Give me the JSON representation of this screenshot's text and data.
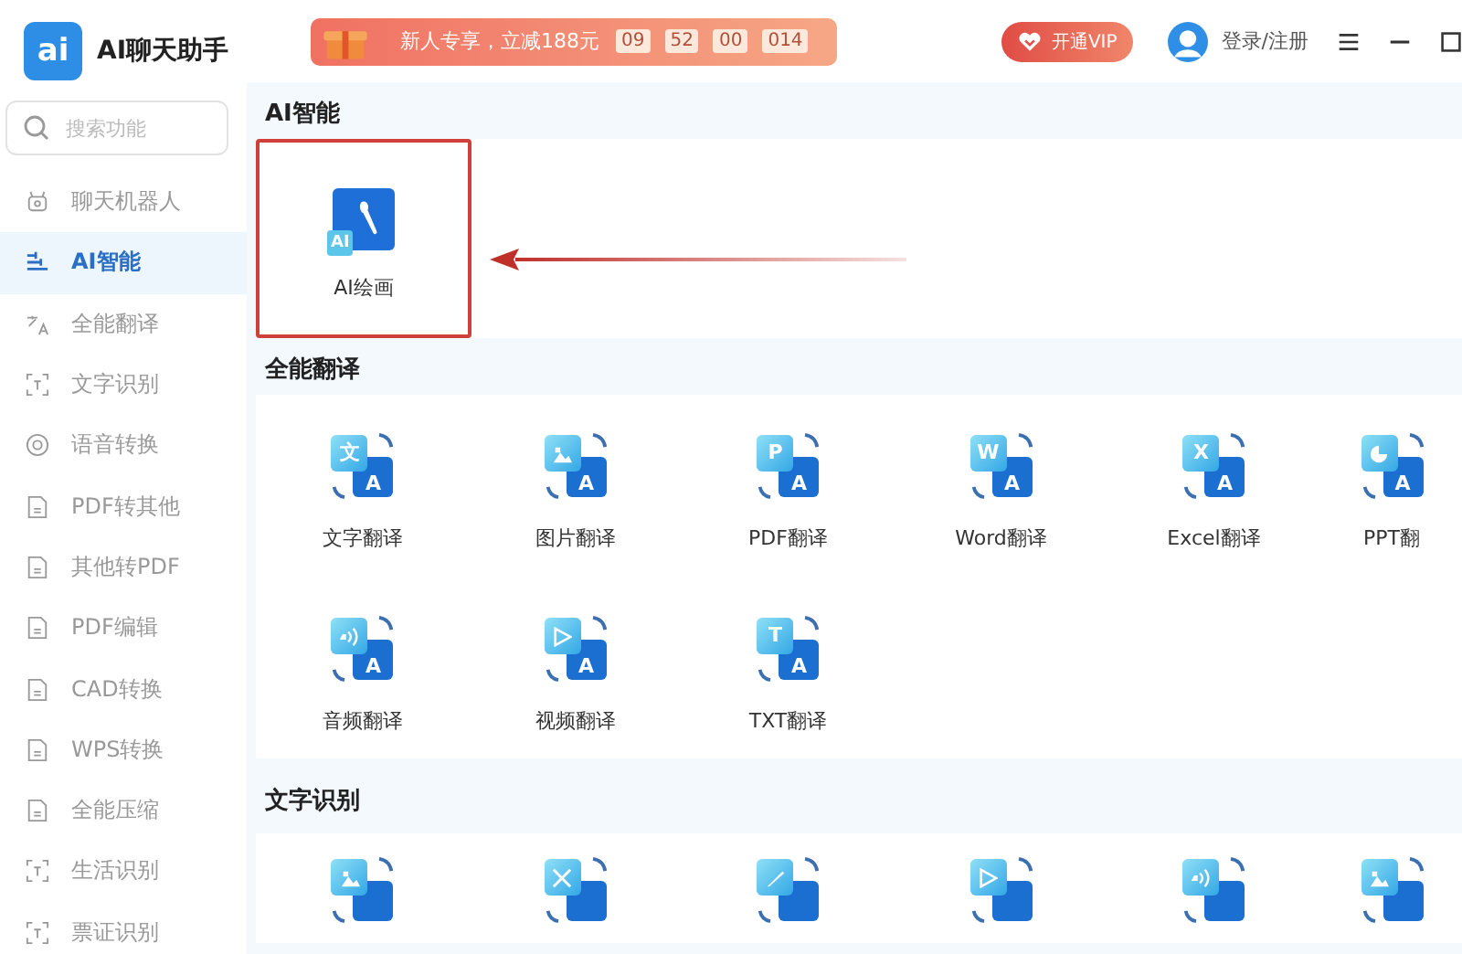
{
  "app": {
    "logo_glyph": "ai",
    "title": "AI聊天助手"
  },
  "search": {
    "placeholder": "搜索功能"
  },
  "sidebar": {
    "items": [
      {
        "label": "聊天机器人",
        "kind": "robot",
        "selected": false
      },
      {
        "label": "AI智能",
        "kind": "nodes",
        "selected": true
      },
      {
        "label": "全能翻译",
        "kind": "translate",
        "selected": false
      },
      {
        "label": "文字识别",
        "kind": "scan",
        "selected": false
      },
      {
        "label": "语音转换",
        "kind": "disc",
        "selected": false
      },
      {
        "label": "PDF转其他",
        "kind": "doc",
        "selected": false
      },
      {
        "label": "其他转PDF",
        "kind": "doc",
        "selected": false
      },
      {
        "label": "PDF编辑",
        "kind": "doc",
        "selected": false
      },
      {
        "label": "CAD转换",
        "kind": "doc",
        "selected": false
      },
      {
        "label": "WPS转换",
        "kind": "doc",
        "selected": false
      },
      {
        "label": "全能压缩",
        "kind": "doc",
        "selected": false
      },
      {
        "label": "生活识别",
        "kind": "scan",
        "selected": false
      },
      {
        "label": "票证识别",
        "kind": "scan",
        "selected": false
      }
    ]
  },
  "promo": {
    "text": "新人专享，立减188元",
    "timer": [
      "09",
      "52",
      "00",
      "014"
    ]
  },
  "vip_button": "开通VIP",
  "login": "登录/注册",
  "sections": [
    {
      "title": "AI智能",
      "tiles": [
        {
          "label": "AI绘画",
          "kind": "paint",
          "glyph": "AI",
          "annotated": true
        }
      ]
    },
    {
      "title": "全能翻译",
      "tiles": [
        {
          "label": "文字翻译",
          "kind": "letter",
          "glyph": "文",
          "target": "A"
        },
        {
          "label": "图片翻译",
          "kind": "image",
          "target": "A"
        },
        {
          "label": "PDF翻译",
          "kind": "letter",
          "glyph": "P",
          "target": "A"
        },
        {
          "label": "Word翻译",
          "kind": "letter",
          "glyph": "W",
          "target": "A"
        },
        {
          "label": "Excel翻译",
          "kind": "letter",
          "glyph": "X",
          "target": "A"
        },
        {
          "label": "PPT翻",
          "kind": "chart",
          "target": "A"
        },
        {
          "label": "音频翻译",
          "kind": "sound",
          "target": "A"
        },
        {
          "label": "视频翻译",
          "kind": "play",
          "target": "A"
        },
        {
          "label": "TXT翻译",
          "kind": "letter",
          "glyph": "T",
          "target": "A"
        }
      ]
    },
    {
      "title": "文字识别",
      "tiles": [
        {
          "kind": "image"
        },
        {
          "kind": "scissors"
        },
        {
          "kind": "pen"
        },
        {
          "kind": "play"
        },
        {
          "kind": "sound"
        },
        {
          "kind": "image"
        }
      ]
    }
  ]
}
